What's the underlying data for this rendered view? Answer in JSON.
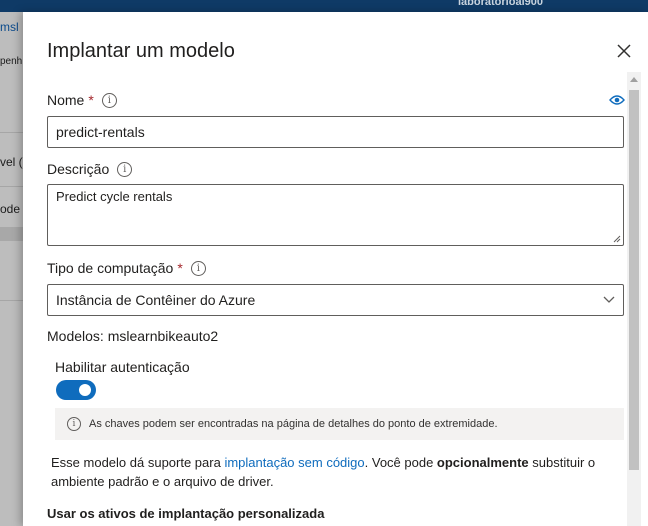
{
  "background": {
    "user": "laboratorioai900",
    "fragments": [
      "msl",
      "penh",
      "vel (",
      "ode"
    ]
  },
  "dialog": {
    "title": "Implantar um modelo",
    "name": {
      "label": "Nome",
      "required": "*",
      "value": "predict-rentals"
    },
    "description": {
      "label": "Descrição",
      "value": "Predict cycle rentals"
    },
    "compute": {
      "label": "Tipo de computação",
      "required": "*",
      "value": "Instância de Contêiner do Azure"
    },
    "models": "Modelos: mslearnbikeauto2",
    "auth": {
      "label": "Habilitar autenticação",
      "enabled": true
    },
    "message": "As chaves podem ser encontradas na página de detalhes do ponto de extremidade.",
    "paragraph": {
      "part1": "Esse modelo dá suporte para ",
      "link": "implantação sem código",
      "part2": ". Você pode ",
      "bold": "opcionalmente",
      "part3": " substituir o ambiente padrão e o arquivo de driver."
    },
    "section": "Usar os ativos de implantação personalizada"
  },
  "colors": {
    "accent": "#0f6cbd",
    "required": "#a4262c"
  }
}
